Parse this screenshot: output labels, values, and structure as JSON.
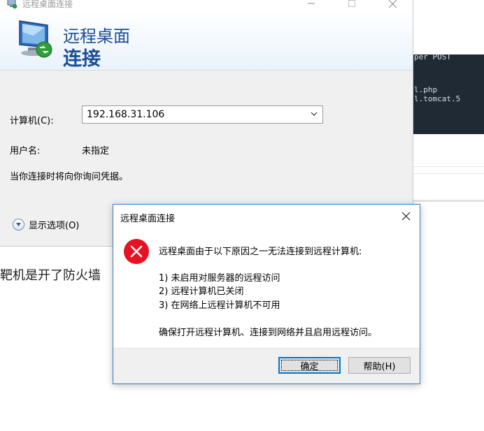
{
  "background": {
    "terminal_lines": [
      "per POST",
      "l.php",
      "l.tomcat.5"
    ],
    "page_text": "靶机是开了防火墙"
  },
  "rdp": {
    "window_title": "远程桌面连接",
    "header_line1": "远程桌面",
    "header_line2": "连接",
    "computer_label": "计算机(C):",
    "computer_value": "192.168.31.106",
    "username_label": "用户名:",
    "username_value": "未指定",
    "credential_note": "当你连接时将向你询问凭据。",
    "show_options": "显示选项(O)"
  },
  "dialog": {
    "title": "远程桌面连接",
    "intro": "远程桌面由于以下原因之一无法连接到远程计算机:",
    "reasons": [
      "1) 未启用对服务器的远程访问",
      "2) 远程计算机已关闭",
      "3) 在网络上远程计算机不可用"
    ],
    "advice": "确保打开远程计算机、连接到网络并且启用远程访问。",
    "ok_label": "确定",
    "help_label": "帮助(H)"
  },
  "colors": {
    "header_text": "#1c4e94",
    "dialog_border": "#3a7ec4",
    "error_red": "#e81123",
    "focus_blue": "#0078d7"
  }
}
